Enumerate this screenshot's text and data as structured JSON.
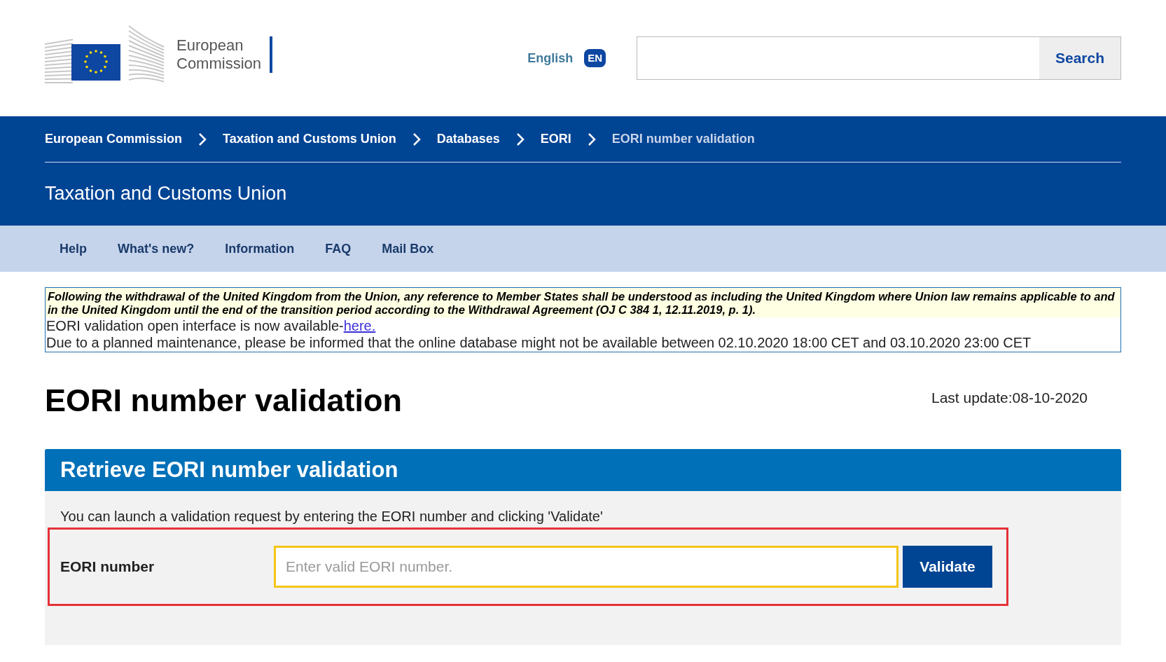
{
  "header": {
    "logo_lines": [
      "European",
      "Commission"
    ],
    "language": {
      "label": "English",
      "code": "EN"
    },
    "search": {
      "button": "Search"
    }
  },
  "breadcrumb": [
    {
      "label": "European Commission",
      "current": false
    },
    {
      "label": "Taxation and Customs Union",
      "current": false
    },
    {
      "label": "Databases",
      "current": false
    },
    {
      "label": "EORI",
      "current": false
    },
    {
      "label": "EORI number validation",
      "current": true
    }
  ],
  "site_title": "Taxation and Customs Union",
  "nav": [
    "Help",
    "What's new?",
    "Information",
    "FAQ",
    "Mail Box"
  ],
  "notice": {
    "highlight": "Following the withdrawal of the United Kingdom from the Union, any reference to Member States shall be understood as including the United Kingdom where Union law remains applicable to and in the United Kingdom until the end of the transition period according to the Withdrawal Agreement (OJ C 384 1, 12.11.2019, p. 1).",
    "interface_text": "EORI validation open interface is now available-",
    "interface_link": "here.",
    "maintenance": "Due to a planned maintenance, please be informed that the online database might not be available between 02.10.2020 18:00 CET and 03.10.2020 23:00 CET"
  },
  "page_title": "EORI number validation",
  "last_update": "Last update:08-10-2020",
  "panel": {
    "title": "Retrieve EORI number validation",
    "instructions": "You can launch a validation request by entering the EORI number and clicking 'Validate'",
    "field_label": "EORI number",
    "placeholder": "Enter valid EORI number.",
    "button": "Validate"
  }
}
